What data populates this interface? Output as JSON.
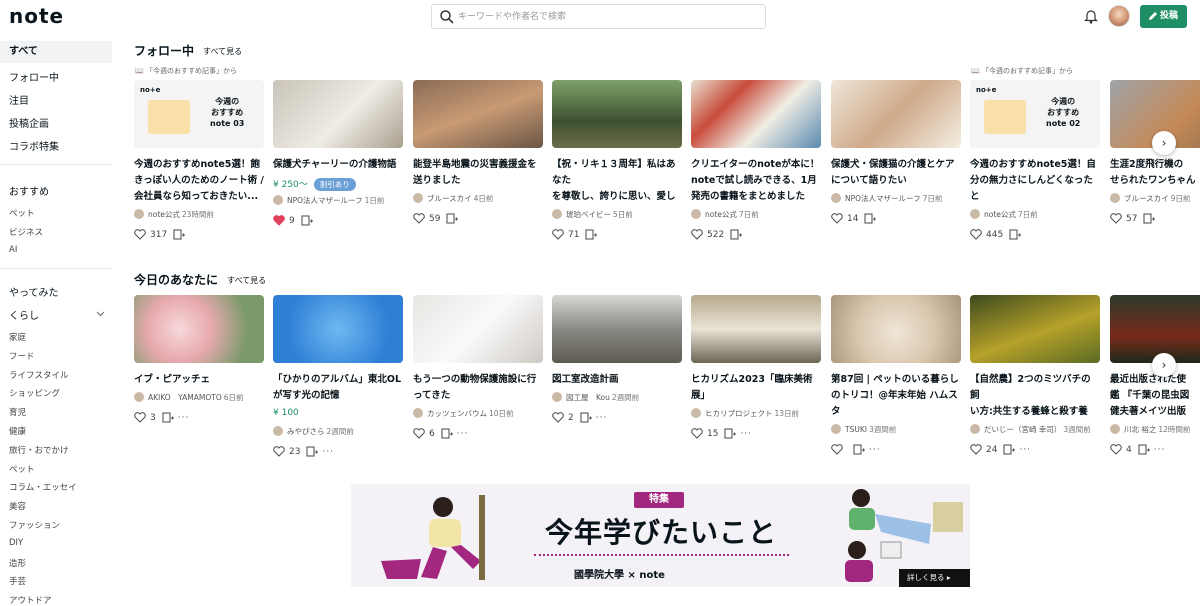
{
  "header": {
    "logo": "note",
    "search_placeholder": "キーワードや作者名で検索",
    "post_label": "投稿"
  },
  "sidebar": {
    "main": [
      "すべて",
      "フォロー中",
      "注目",
      "投稿企画",
      "コラボ特集"
    ],
    "recommend_title": "おすすめ",
    "recommend": [
      "ペット",
      "ビジネス",
      "AI"
    ],
    "tried": "やってみた",
    "kurashi": "くらし",
    "kurashi_items": [
      "家庭",
      "フード",
      "ライフスタイル",
      "ショッピング",
      "育児",
      "健康",
      "旅行・おでかけ",
      "ペット",
      "コラム・エッセイ",
      "美容",
      "ファッション",
      "DIY",
      "造形",
      "手芸",
      "アウトドア"
    ]
  },
  "following": {
    "title": "フォロー中",
    "see_all": "すべて見る",
    "pick_labels": [
      "「今週のおすすめ記事」から",
      "「今週のおすすめ記事」から"
    ],
    "cards": [
      {
        "title": "今週のおすすめnote5選！飽\nきっぽい人のためのノート術 /\n会社員なら知っておきたい...",
        "author": "note公式",
        "time": "23時間前",
        "likes": "317",
        "thumb_text": "今週の\nおすすめ\nnote 03"
      },
      {
        "title": "保護犬チャーリーの介護物語",
        "price": "¥ 250〜",
        "badge": "割引あり",
        "author": "NPO法人マザールーフ",
        "time": "1日前",
        "likes": "9"
      },
      {
        "title": "能登半島地震の災害義援金を\n送りました",
        "author": "ブルースカイ",
        "time": "4日前",
        "likes": "59"
      },
      {
        "title": "【祝・リキ１３周年】私はあなた\nを尊敬し、誇りに思い、愛して\nいます",
        "author": "琥珀ベイビー",
        "time": "5日前",
        "likes": "71"
      },
      {
        "title": "クリエイターのnoteが本に！\nnoteで試し読みできる、1月\n発売の書籍をまとめました",
        "author": "note公式",
        "time": "7日前",
        "likes": "522"
      },
      {
        "title": "保護犬・保護猫の介護とケア\nについて語りたい",
        "author": "NPO法人マザールーフ",
        "time": "7日前",
        "likes": "14"
      },
      {
        "title": "今週のおすすめnote5選！自\n分の無力さにしんどくなったと\nきのヒント / 引っ越し作業...",
        "author": "note公式",
        "time": "7日前",
        "likes": "445",
        "thumb_text": "今週の\nおすすめ\nnote 02"
      },
      {
        "title": "生涯2度飛行機の\nせられたワンちゃん",
        "author": "ブルースカイ",
        "time": "9日前",
        "likes": "57"
      }
    ]
  },
  "today": {
    "title": "今日のあなたに",
    "see_all": "すべて見る",
    "cards": [
      {
        "title": "イブ・ピアッチェ",
        "author": "AKIKO　YAMAMOTO",
        "time": "6日前",
        "likes": "3"
      },
      {
        "title": "「ひかりのアルバム」東北OL\nが写す光の記憶",
        "price": "¥ 100",
        "author": "みやぴさら",
        "time": "2週間前",
        "likes": "23"
      },
      {
        "title": "もう一つの動物保護施設に行\nってきた",
        "author": "カッツェンバウム",
        "time": "10日前",
        "likes": "6"
      },
      {
        "title": "図工室改造計画",
        "author": "図工屋　Kou",
        "time": "2週間前",
        "likes": "2"
      },
      {
        "title": "ヒカリズム2023「臨床美術\n展」",
        "author": "ヒカリプロジェクト",
        "time": "13日前",
        "likes": "15"
      },
      {
        "title": "第87回 | ペットのいる暮らし\nのトリコ！@年末年始 ハムスタ\nー編",
        "author": "TSUKI",
        "time": "3週間前",
        "likes": ""
      },
      {
        "title": "【自然農】2つのミツバチの飼\nい方:共生する養蜂と殺す養\n蜂",
        "author": "だいじー（宮崎 幸司）",
        "time": "3週間前",
        "likes": "24"
      },
      {
        "title": "最近出版された使\n鑑 『千葉の昆虫図\n健夫著メイツ出版",
        "author": "川北 裕之",
        "time": "12時間前",
        "likes": "4"
      }
    ]
  },
  "banner": {
    "tag": "特集",
    "title": "今年学びたいこと",
    "sponsor": "國學院大學 × note",
    "more": "詳しく見る ▸"
  }
}
